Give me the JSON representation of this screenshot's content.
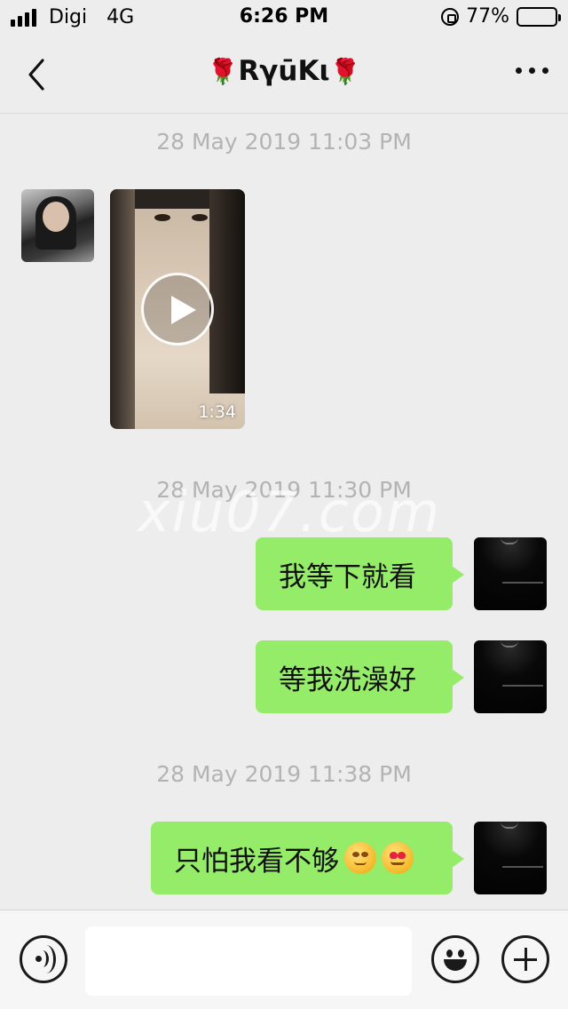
{
  "status_bar": {
    "carrier": "Digi",
    "network": "4G",
    "time": "6:26 PM",
    "battery_percent": "77%",
    "battery_level": 0.77
  },
  "header": {
    "title": "RγūKι",
    "title_decoration": "🌹"
  },
  "messages": {
    "timestamps": [
      "28 May 2019 11:03 PM",
      "28 May 2019 11:30 PM",
      "28 May 2019 11:38 PM"
    ],
    "video": {
      "duration": "1:34"
    },
    "outgoing": [
      "我等下就看",
      "等我洗澡好",
      "只怕我看不够"
    ]
  },
  "watermark": "xiu07.com",
  "colors": {
    "bubble_outgoing": "#95ec69",
    "background": "#ededed",
    "battery": "#f5c400"
  },
  "icons": [
    "back-arrow-icon",
    "more-icon",
    "play-icon",
    "voice-icon",
    "emoji-icon",
    "plus-icon"
  ]
}
